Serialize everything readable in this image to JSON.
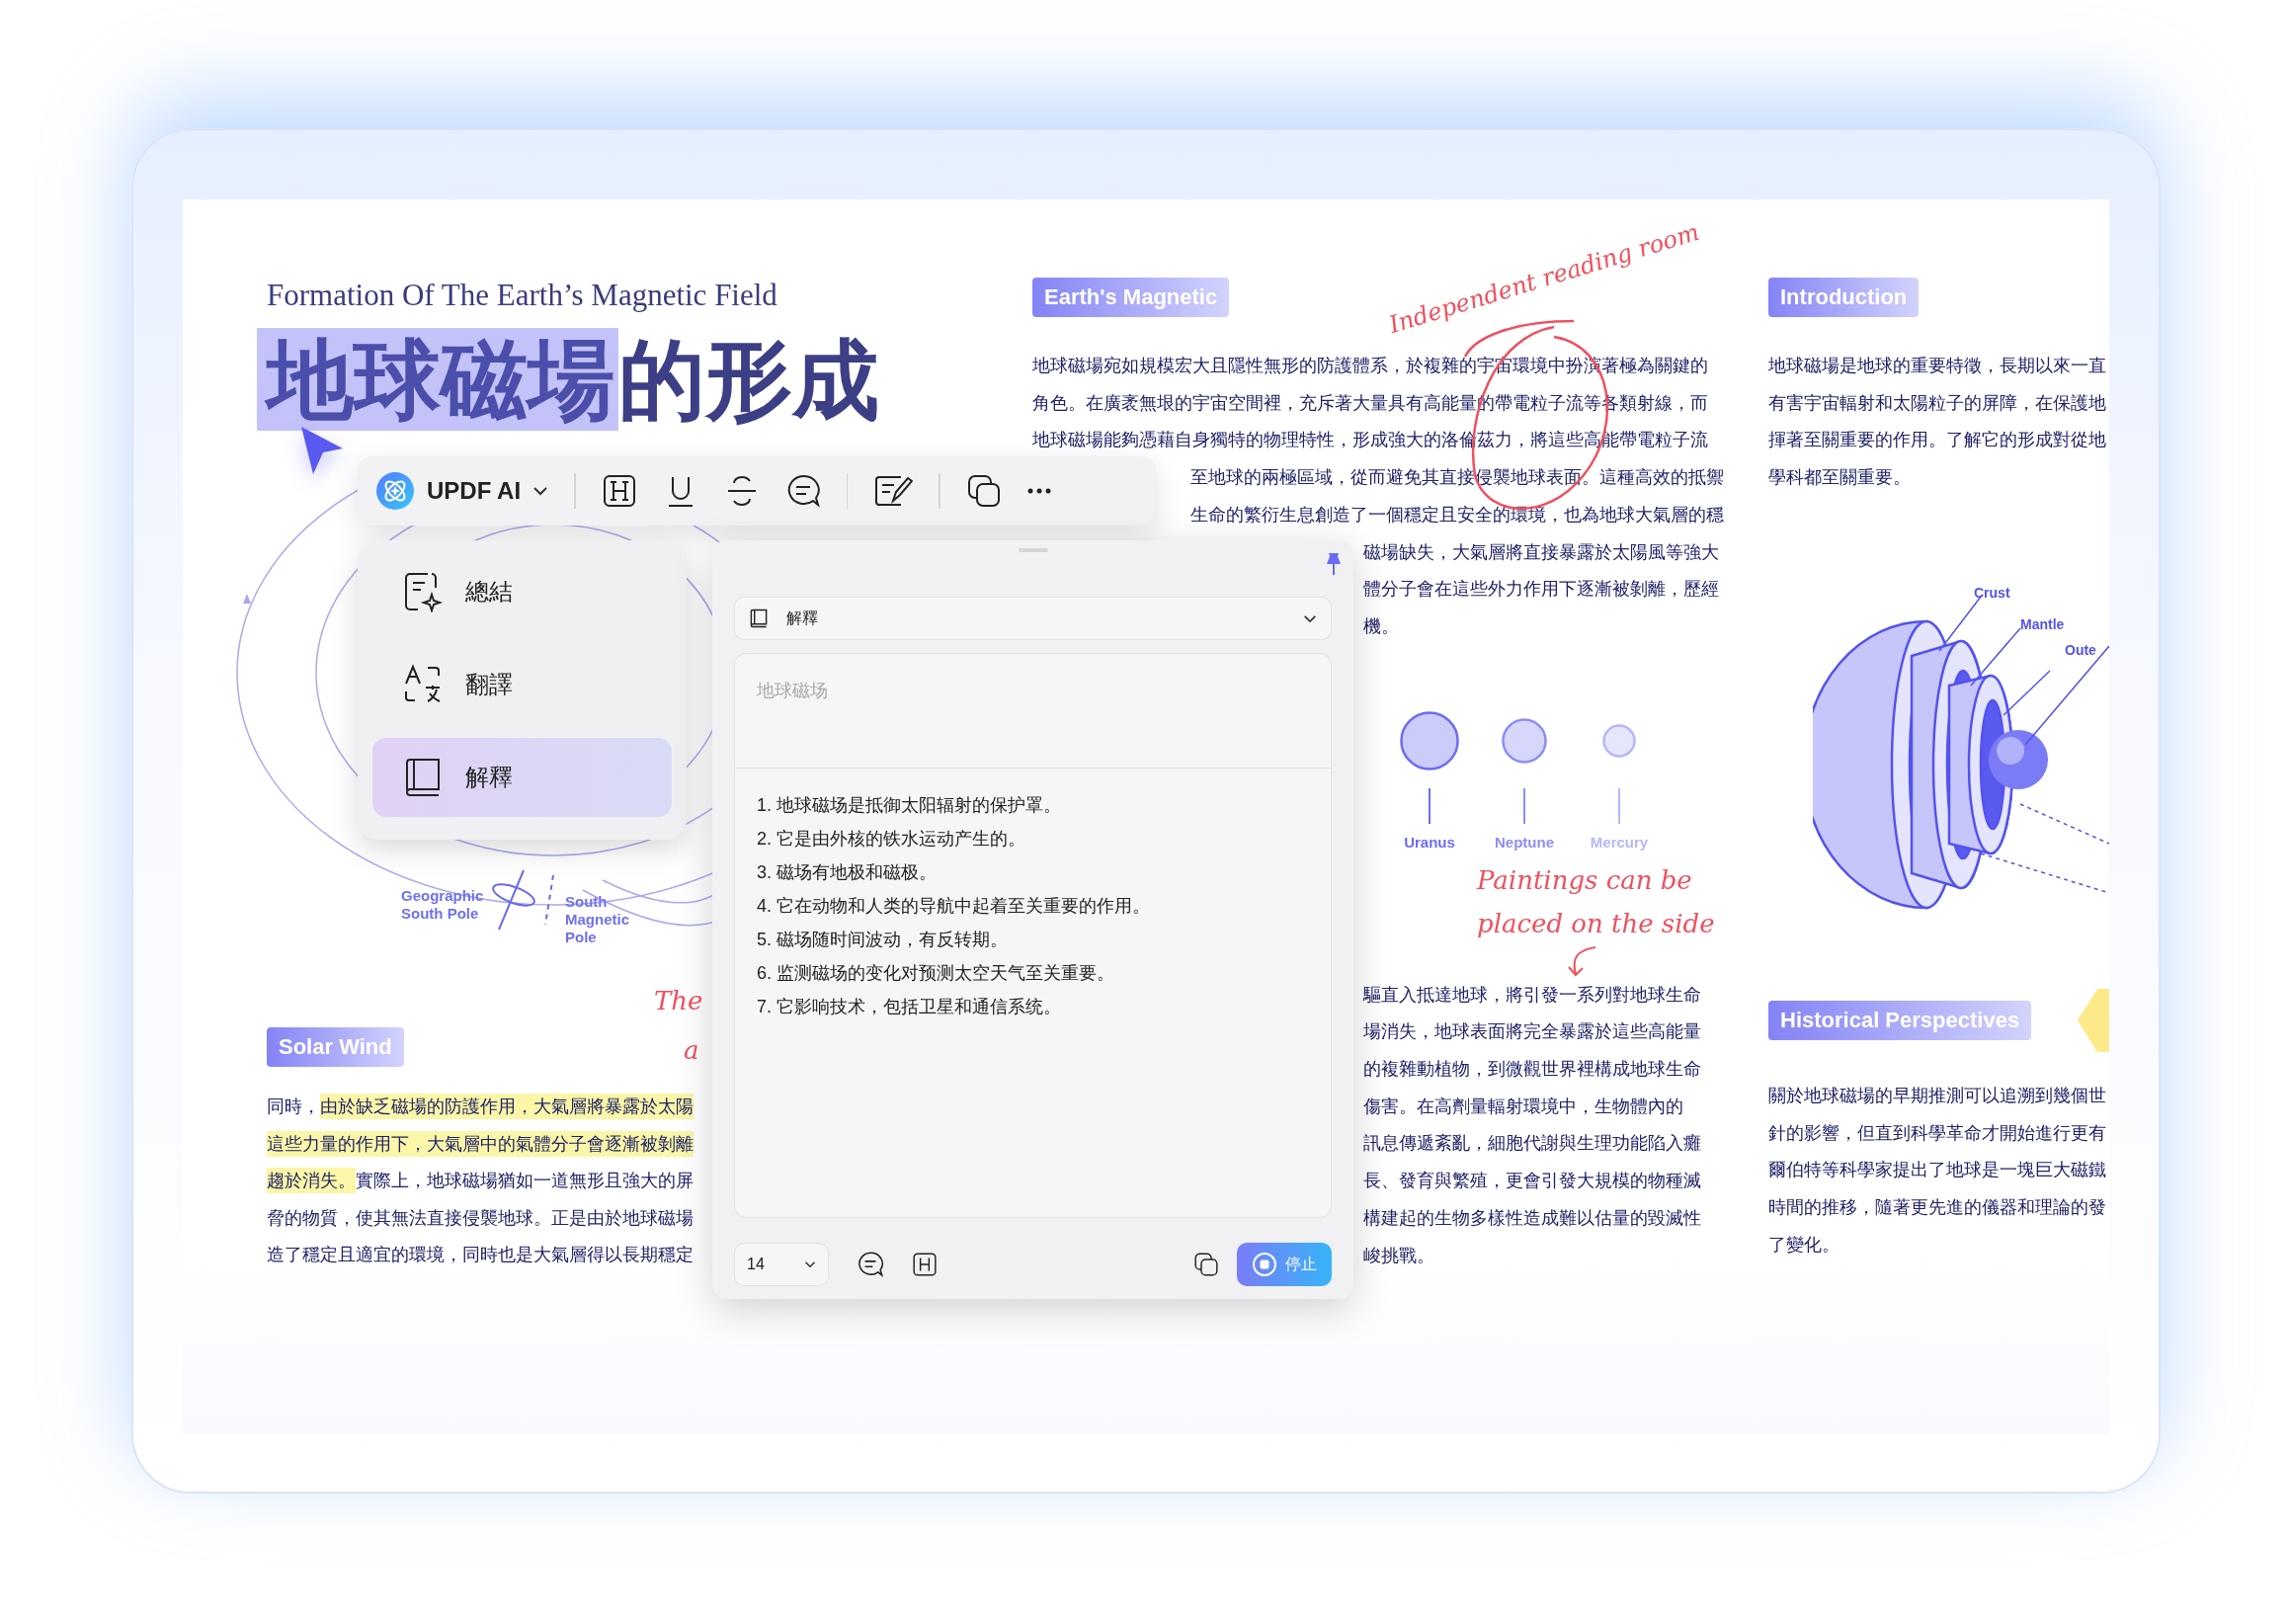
{
  "document": {
    "subtitle": "Formation Of The Earth’s Magnetic Field",
    "title": [
      {
        "text": "地球磁場",
        "highlighted": true
      },
      {
        "text": "的形成",
        "highlighted": false
      }
    ],
    "field_labels": [
      "Geographic South Pole",
      "South Magnetic Pole"
    ],
    "notes": [
      "The",
      "a"
    ],
    "solar_wind": {
      "heading": "Solar Wind",
      "lines": [
        [
          {
            "text": "同時，",
            "highlighted": false
          },
          {
            "text": "由於缺乏磁場的防護作用，大氣層將暴露於太陽",
            "highlighted": true
          }
        ],
        [
          {
            "text": "這些力量的作用下，大氣層中的氣體分子會逐漸被剝離",
            "highlighted": true
          }
        ],
        [
          {
            "text": "趨於消失。",
            "highlighted": true
          },
          {
            "text": "實際上，地球磁場猶如一道無形且強大的屏",
            "highlighted": false
          }
        ],
        [
          {
            "text": "脅的物質，使其無法直接侵襲地球。正是由於地球磁場",
            "highlighted": false
          }
        ],
        [
          {
            "text": "造了穩定且適宜的環境，同時也是大氣層得以長期穩定",
            "highlighted": false
          }
        ]
      ]
    },
    "magnetic": {
      "heading": "Earth's Magnetic",
      "lines": [
        {
          "kind": "full",
          "text": "地球磁場宛如規模宏大且隱性無形的防護體系，於複雜的宇宙環境中扮演著極為關鍵的"
        },
        {
          "kind": "full",
          "text": "角色。在廣袤無垠的宇宙空間裡，充斥著大量具有高能量的帶電粒子流等各類射線，而"
        },
        {
          "kind": "full",
          "text": "地球磁場能夠憑藉自身獨特的物理特性，形成強大的洛倫茲力，將這些高能帶電粒子流"
        },
        {
          "kind": "tail",
          "text": "至地球的兩極區域，從而避免其直接侵襲地球表面。這種高效的抵禦"
        },
        {
          "kind": "tail",
          "text": "生命的繁衍生息創造了一個穩定且安全的環境，也為地球大氣層的穩"
        },
        {
          "kind": "side",
          "text": "磁場缺失，大氣層將直接暴露於太陽風等強大"
        },
        {
          "kind": "side",
          "text": "體分子會在這些外力作用下逐漸被剝離，歷經"
        },
        {
          "kind": "side",
          "text": "機。"
        }
      ]
    },
    "reading_note": "Independent reading room",
    "planets": [
      {
        "name": "Uranus",
        "color": "#6c6cf4"
      },
      {
        "name": "Neptune",
        "color": "#8d8df7"
      },
      {
        "name": "Mercury",
        "color": "#b6b6fa"
      }
    ],
    "side_note": "Paintings can be placed on the side",
    "lower_lines": [
      "驅直入抵達地球，將引發一系列對地球生命",
      "場消失，地球表面將完全暴露於這些高能量",
      "的複雜動植物，到微觀世界裡構成地球生命",
      "傷害。在高劑量輻射環境中，生物體內的",
      "訊息傳遞紊亂，細胞代謝與生理功能陷入癱",
      "長、發育與繁殖，更會引發大規模的物種滅",
      "構建起的生物多樣性造成難以估量的毀滅性",
      "峻挑戰。"
    ],
    "introduction": {
      "heading": "Introduction",
      "lines": [
        "地球磁場是地球的重要特徵，長期以來一直",
        "有害宇宙輻射和太陽粒子的屏障，在保護地",
        "揮著至關重要的作用。了解它的形成對從地",
        "學科都至關重要。"
      ]
    },
    "layer_labels": [
      "Crust",
      "Mantle",
      "Oute"
    ],
    "history": {
      "heading": "Historical Perspectives",
      "lines": [
        "關於地球磁場的早期推測可以追溯到幾個世",
        "針的影響，但直到科學革命才開始進行更有",
        "爾伯特等科學家提出了地球是一塊巨大磁鐵",
        "時間的推移，隨著更先進的儀器和理論的發",
        "了變化。"
      ]
    }
  },
  "toolbar": {
    "brand": "UPDF AI"
  },
  "ai_menu": {
    "items": [
      {
        "kind": "summarize",
        "label": "總結",
        "selected": false
      },
      {
        "kind": "translate",
        "label": "翻譯",
        "selected": false
      },
      {
        "kind": "explain",
        "label": "解釋",
        "selected": true
      }
    ]
  },
  "ai_panel": {
    "mode": "解釋",
    "placeholder": "地球磁场",
    "results": [
      "1. 地球磁场是抵御太阳辐射的保护罩。",
      "2. 它是由外核的铁水运动产生的。",
      "3. 磁场有地极和磁极。",
      "4. 它在动物和人类的导航中起着至关重要的作用。",
      "5. 磁场随时间波动，有反转期。",
      "6. 监测磁场的变化对预测太空天气至关重要。",
      "7. 它影响技术，包括卫星和通信系统。"
    ],
    "font_size": "14",
    "stop": "停止"
  }
}
